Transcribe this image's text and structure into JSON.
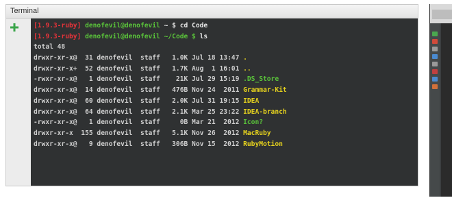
{
  "terminal_panel": {
    "title": "Terminal",
    "new_session_icon": "plus-icon",
    "accent_plus": "#3aa54a"
  },
  "terminal": {
    "lines": [
      [
        {
          "t": "[1.9.3-ruby] ",
          "c": "red"
        },
        {
          "t": "denofevil@denofevil",
          "c": "green"
        },
        {
          "t": " ~ $ ",
          "c": "white"
        },
        {
          "t": "cd Code",
          "c": "white"
        }
      ],
      [
        {
          "t": "[1.9.3-ruby] ",
          "c": "red"
        },
        {
          "t": "denofevil@denofevil",
          "c": "green"
        },
        {
          "t": " ~/Code $ ",
          "c": "green"
        },
        {
          "t": "ls",
          "c": "white"
        }
      ],
      [
        {
          "t": "total 48",
          "c": "text"
        }
      ],
      [
        {
          "t": "drwxr-xr-x@  31 denofevil  staff   1.0K Jul 18 13:47 ",
          "c": "text"
        },
        {
          "t": ".",
          "c": "yellow"
        }
      ],
      [
        {
          "t": "drwxr-xr-x+  52 denofevil  staff   1.7K Aug  1 16:01 ",
          "c": "text"
        },
        {
          "t": "..",
          "c": "yellow"
        }
      ],
      [
        {
          "t": "-rwxr-xr-x@   1 denofevil  staff    21K Jul 29 15:19 ",
          "c": "text"
        },
        {
          "t": ".DS_Store",
          "c": "green"
        }
      ],
      [
        {
          "t": "drwxr-xr-x@  14 denofevil  staff   476B Nov 24  2011 ",
          "c": "text"
        },
        {
          "t": "Grammar-Kit",
          "c": "yellow"
        }
      ],
      [
        {
          "t": "drwxr-xr-x@  60 denofevil  staff   2.0K Jul 31 19:15 ",
          "c": "text"
        },
        {
          "t": "IDEA",
          "c": "yellow"
        }
      ],
      [
        {
          "t": "drwxr-xr-x@  64 denofevil  staff   2.1K Mar 25 23:22 ",
          "c": "text"
        },
        {
          "t": "IDEA-branch",
          "c": "yellow"
        }
      ],
      [
        {
          "t": "-rwxr-xr-x@   1 denofevil  staff     0B Mar 21  2012 ",
          "c": "text"
        },
        {
          "t": "Icon?",
          "c": "green"
        }
      ],
      [
        {
          "t": "drwxr-xr-x  155 denofevil  staff   5.1K Nov 26  2012 ",
          "c": "text"
        },
        {
          "t": "MacRuby",
          "c": "yellow"
        }
      ],
      [
        {
          "t": "drwxr-xr-x@   9 denofevil  staff   306B Nov 15  2012 ",
          "c": "text"
        },
        {
          "t": "RubyMotion",
          "c": "yellow"
        }
      ]
    ]
  },
  "ide_window": {
    "tool_colors": [
      "#4aa84f",
      "#d04a3a",
      "#9a9a9a",
      "#4a8ad0",
      "#9a9a9a",
      "#c04040",
      "#4a8ad0",
      "#d0703a"
    ]
  }
}
